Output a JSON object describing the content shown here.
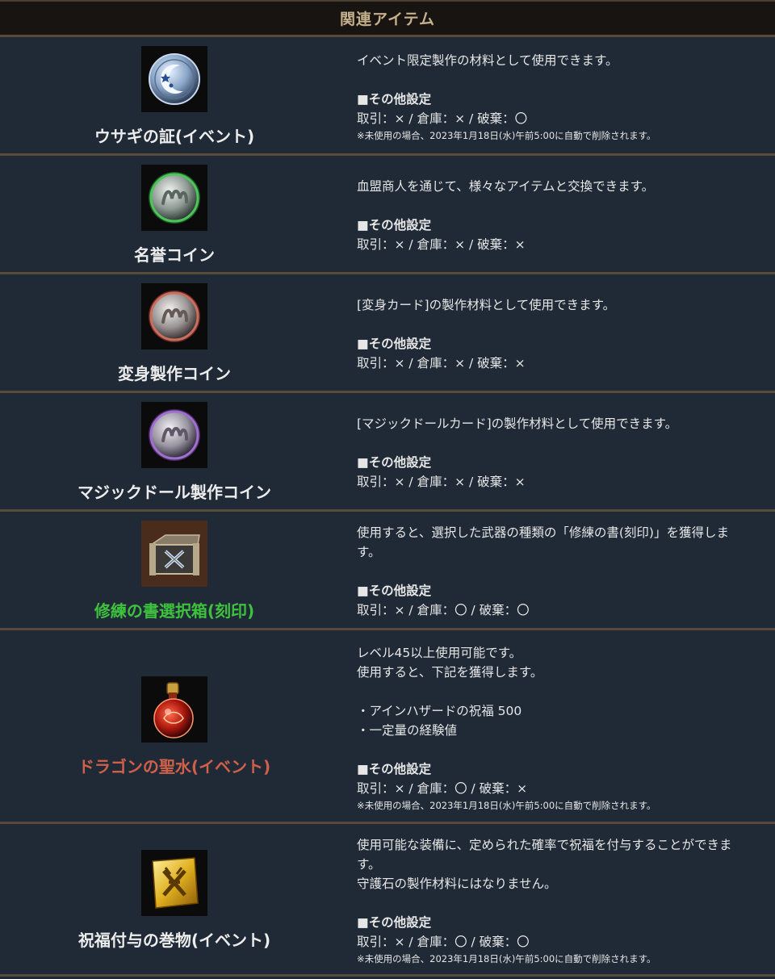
{
  "header": {
    "title": "関連アイテム"
  },
  "items": [
    {
      "name": "ウサギの証(イベント)",
      "name_color": "#ececec",
      "icon": "moon-star-coin-icon",
      "desc": [
        "イベント限定製作の材料として使用できます。"
      ],
      "section_title": "■その他設定",
      "settings": "取引：× / 倉庫：× / 破棄：〇",
      "note": "※未使用の場合、2023年1月18日(水)午前5:00に自動で削除されます。"
    },
    {
      "name": "名誉コイン",
      "name_color": "#ececec",
      "icon": "honor-coin-icon",
      "desc": [
        "血盟商人を通じて、様々なアイテムと交換できます。"
      ],
      "section_title": "■その他設定",
      "settings": "取引：× / 倉庫：× / 破棄：×",
      "note": ""
    },
    {
      "name": "変身製作コイン",
      "name_color": "#ececec",
      "icon": "transform-coin-icon",
      "desc": [
        "[変身カード]の製作材料として使用できます。"
      ],
      "section_title": "■その他設定",
      "settings": "取引：× / 倉庫：× / 破棄：×",
      "note": ""
    },
    {
      "name": "マジックドール製作コイン",
      "name_color": "#ececec",
      "icon": "magic-doll-coin-icon",
      "desc": [
        "[マジックドールカード]の製作材料として使用できます。"
      ],
      "section_title": "■その他設定",
      "settings": "取引：× / 倉庫：× / 破棄：×",
      "note": ""
    },
    {
      "name": "修練の書選択箱(刻印)",
      "name_color": "#3ec23e",
      "icon": "treasure-chest-icon",
      "desc": [
        "使用すると、選択した武器の種類の「修練の書(刻印)」を獲得しま",
        "す。"
      ],
      "section_title": "■その他設定",
      "settings": "取引：× / 倉庫：〇 / 破棄：〇",
      "note": ""
    },
    {
      "name": "ドラゴンの聖水(イベント)",
      "name_color": "#d0604a",
      "icon": "holy-water-potion-icon",
      "desc": [
        "レベル45以上使用可能です。",
        "使用すると、下記を獲得します。",
        "",
        "・アインハザードの祝福 500",
        "・一定量の経験値"
      ],
      "section_title": "■その他設定",
      "settings": "取引：× / 倉庫：〇 / 破棄：×",
      "note": "※未使用の場合、2023年1月18日(水)午前5:00に自動で削除されます。"
    },
    {
      "name": "祝福付与の巻物(イベント)",
      "name_color": "#ececec",
      "icon": "blessing-scroll-icon",
      "desc": [
        "使用可能な装備に、定められた確率で祝福を付与することができま",
        "す。",
        "守護石の製作材料にはなりません。"
      ],
      "section_title": "■その他設定",
      "settings": "取引：× / 倉庫：〇 / 破棄：〇",
      "note": "※未使用の場合、2023年1月18日(水)午前5:00に自動で削除されます。"
    }
  ]
}
